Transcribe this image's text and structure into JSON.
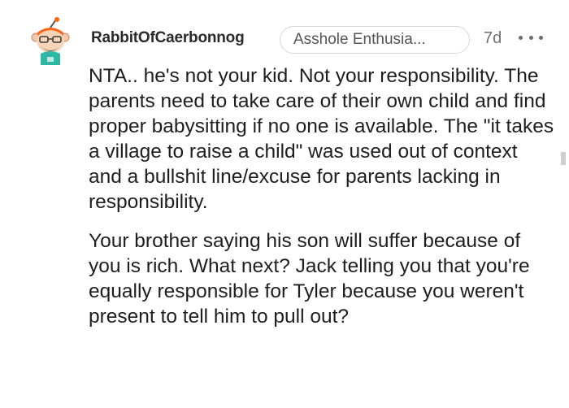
{
  "comment": {
    "username": "RabbitOfCaerbonnog",
    "flair": "Asshole Enthusia...",
    "age": "7d",
    "avatar_icon": "reddit-avatar-icon",
    "more_icon": "more-options-icon",
    "paragraphs": [
      "NTA.. he's not your kid. Not your responsibility. The parents need to take care of their own child and find proper babysitting if no one is available. The \"it takes a village to raise a child\" was used out of context and a bullshit line/excuse for parents lacking in responsibility.",
      "Your brother saying his son will suffer because of you is rich. What next? Jack telling you that you're equally responsible for Tyler because you weren't present to tell him to pull out?"
    ]
  },
  "colors": {
    "flair_border": "#d6d6d6",
    "meta_text": "#707070",
    "avatar_orange": "#ff6314",
    "avatar_teal": "#2fb7a5"
  }
}
